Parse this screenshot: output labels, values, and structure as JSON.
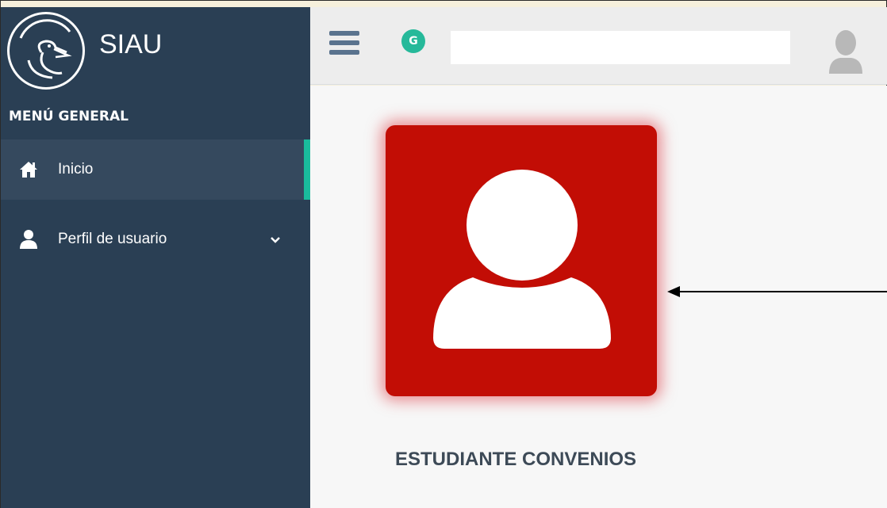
{
  "sidebar": {
    "brand": "SIAU",
    "logo_icon": "unillanos-heron-logo",
    "menu_heading": "MENÚ GENERAL",
    "items": [
      {
        "label": "Inicio",
        "icon": "home-icon",
        "active": true
      },
      {
        "label": "Perfil de usuario",
        "icon": "user-icon",
        "active": false,
        "expandable": true
      }
    ]
  },
  "topbar": {
    "menu_icon": "hamburger-icon",
    "badge_letter": "G",
    "search_value": "",
    "user_icon": "user-avatar-icon"
  },
  "main": {
    "tile_icon": "user-profile-icon",
    "tile_label": "ESTUDIANTE CONVENIOS"
  },
  "colors": {
    "sidebar_bg": "#2a3f54",
    "active_indicator": "#1abb9c",
    "tile_red": "#c20d05",
    "badge_green": "#26b99a",
    "topbar_bg": "#ededed",
    "content_bg": "#f7f7f7"
  }
}
